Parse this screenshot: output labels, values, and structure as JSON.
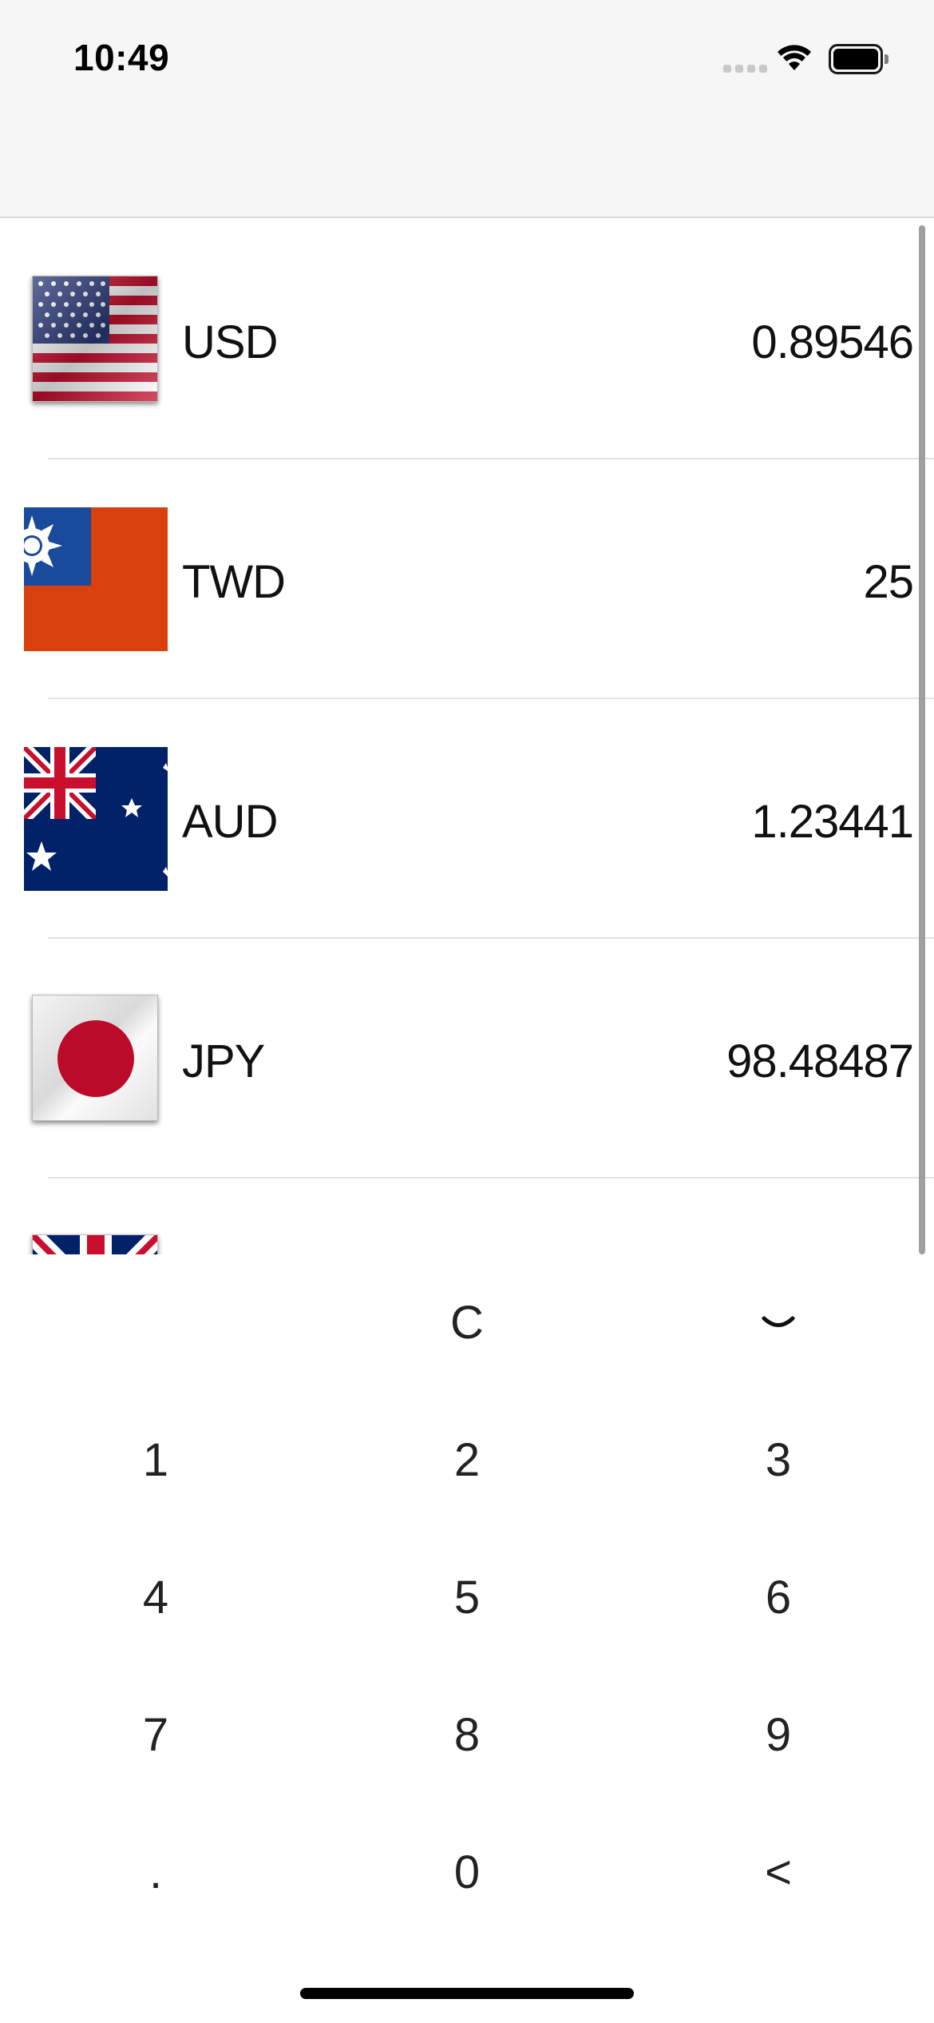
{
  "status_bar": {
    "time": "10:49",
    "signal_icon": "cellular-signal-icon",
    "wifi_icon": "wifi-icon",
    "battery_icon": "battery-icon"
  },
  "currencies": [
    {
      "code": "USD",
      "value": "0.89546",
      "flag": "usa-flag-icon"
    },
    {
      "code": "TWD",
      "value": "25",
      "flag": "taiwan-flag-icon"
    },
    {
      "code": "AUD",
      "value": "1.23441",
      "flag": "australia-flag-icon"
    },
    {
      "code": "JPY",
      "value": "98.48487",
      "flag": "japan-flag-icon"
    },
    {
      "code": "",
      "value": "",
      "flag": "uk-flag-icon"
    }
  ],
  "keypad": {
    "clear": "C",
    "collapse_icon": "chevron-down-icon",
    "digits": [
      "1",
      "2",
      "3",
      "4",
      "5",
      "6",
      "7",
      "8",
      "9"
    ],
    "dot": ".",
    "zero": "0",
    "backspace": "<"
  },
  "colors": {
    "header_bg": "#f6f6f6",
    "separator": "#e2e2e2",
    "text": "#111111"
  }
}
